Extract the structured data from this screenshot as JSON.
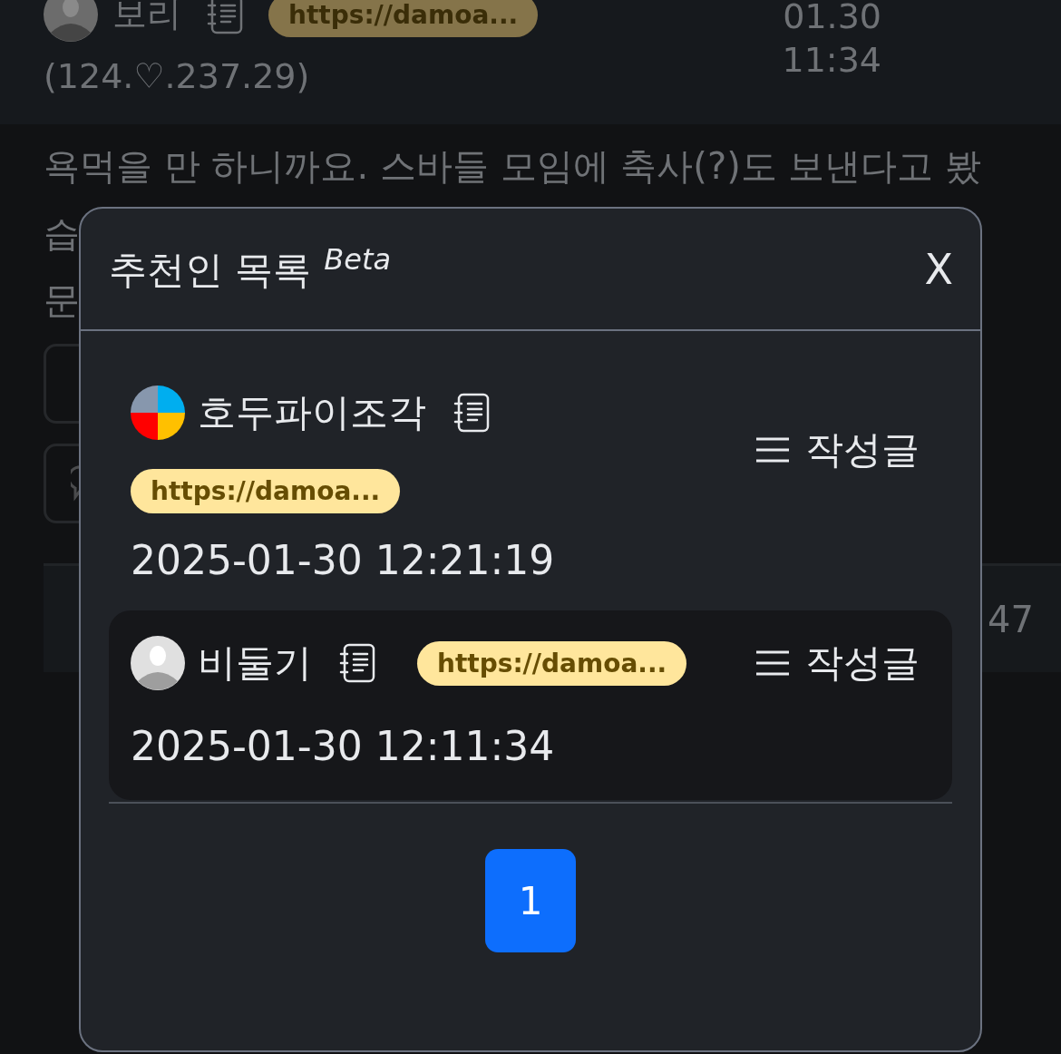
{
  "background": {
    "author": {
      "name": "보리",
      "link": "https://damoa...",
      "ip": "(124.♡.237.29)",
      "date": "01.30",
      "time": "11:34"
    },
    "body_lines": [
      "욕먹을 만 하니까요. 스바들 모임에 축사(?)도 보낸다고 봤",
      "습",
      "문"
    ],
    "footer_count": "47"
  },
  "modal": {
    "title": "추천인 목록",
    "badge": "Beta",
    "close": "X",
    "items": [
      {
        "kind": "stacked",
        "highlighted": false,
        "avatar": {
          "kind": "quadrants"
        },
        "name": "호두파이조각",
        "link": "https://damoa...",
        "posts": "작성글",
        "date": "2025-01-30 12:21:19"
      },
      {
        "kind": "inline",
        "highlighted": true,
        "avatar": {
          "kind": "person"
        },
        "name": "비둘기",
        "link": "https://damoa...",
        "posts": "작성글",
        "date": "2025-01-30 12:11:34"
      }
    ],
    "pages": [
      {
        "label": "1",
        "selected": true
      }
    ]
  }
}
